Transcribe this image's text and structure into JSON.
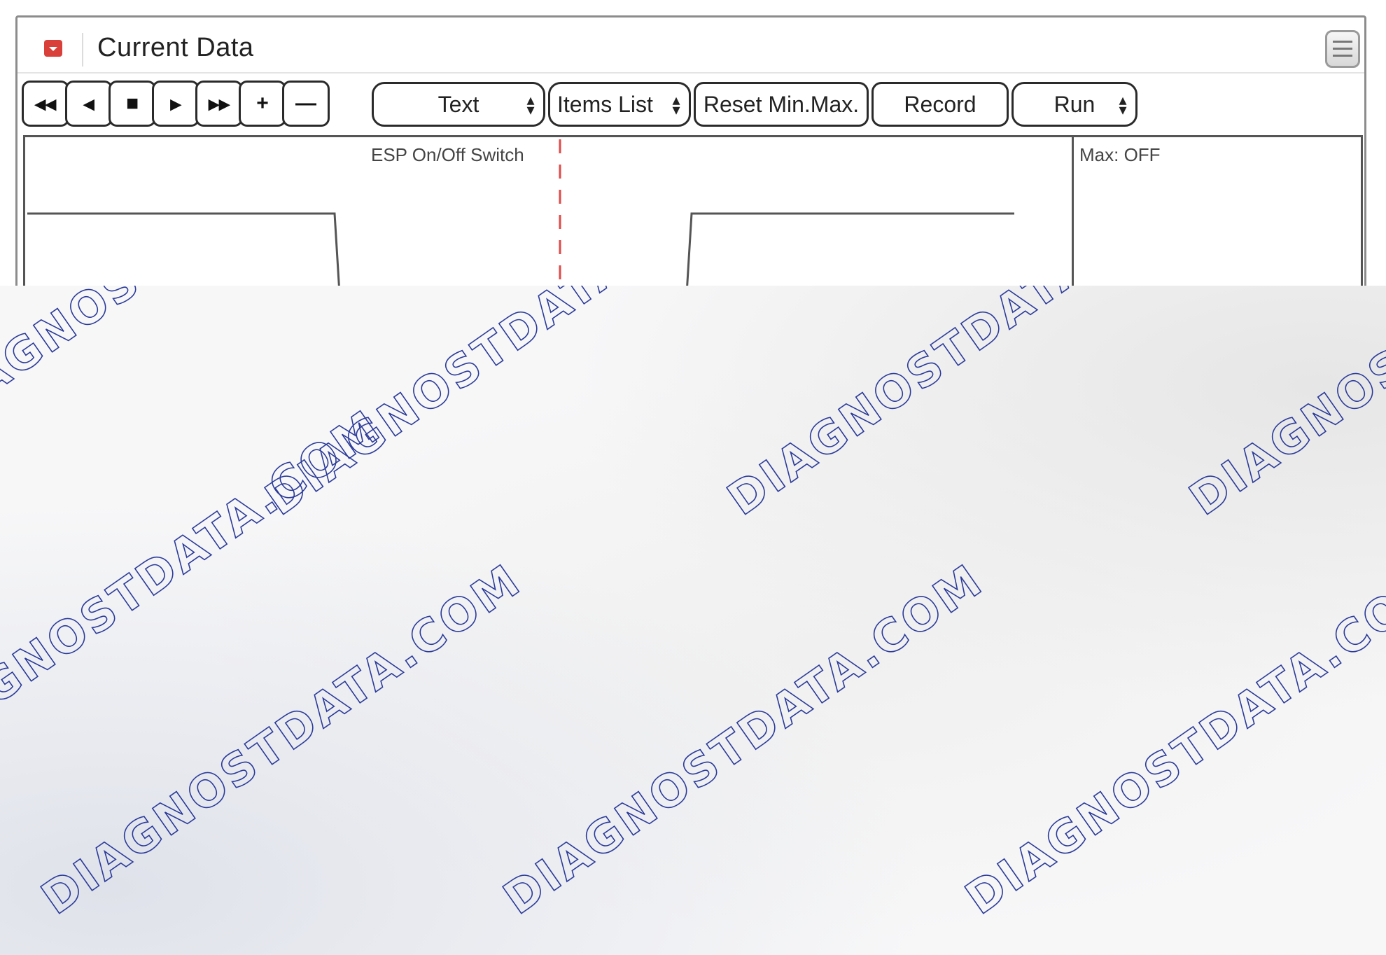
{
  "window": {
    "title": "Current Data",
    "menu_icon": "hamburger-icon"
  },
  "toolbar": {
    "first": "◂◂",
    "prev": "◂",
    "stop": "■",
    "next": "▸",
    "last": "▸▸",
    "add": "+",
    "remove": "—",
    "view_select": "Text",
    "items_select": "Items List",
    "reset_label": "Reset Min.Max.",
    "record_label": "Record",
    "run_select": "Run"
  },
  "graph": {
    "label": "ESP On/Off Switch",
    "side_label": "Max: OFF"
  },
  "watermark": {
    "text": "DIAGNOSTDATA.COM",
    "color": "#2a3a9a"
  }
}
